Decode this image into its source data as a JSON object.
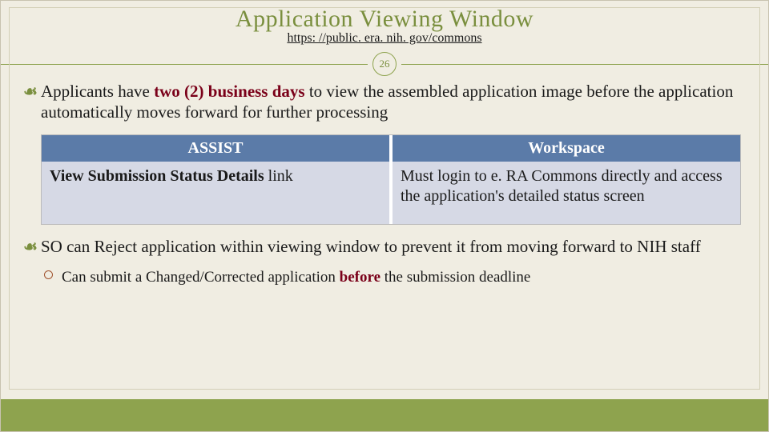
{
  "slide": {
    "title": "Application Viewing Window",
    "link_text": "https: //public. era. nih. gov/commons",
    "link_href": "https://public.era.nih.gov/commons",
    "page_number": "26",
    "bullet1": {
      "lead": "Applicants have ",
      "emphasis": "two (2) business days",
      "tail": " to view the assembled application image before the application automatically moves forward for further processing"
    },
    "table": {
      "col1": {
        "header": "ASSIST",
        "body_strong": "View Submission Status Details",
        "body_tail": " link"
      },
      "col2": {
        "header": "Workspace",
        "body": "Must login to e. RA Commons directly and access the application's detailed status screen"
      }
    },
    "bullet2": {
      "text": "SO can Reject application within viewing window to prevent it from moving forward to NIH staff"
    },
    "sub_bullet": {
      "lead": "Can submit a Changed/Corrected application ",
      "emphasis": "before",
      "tail": " the submission deadline"
    }
  }
}
